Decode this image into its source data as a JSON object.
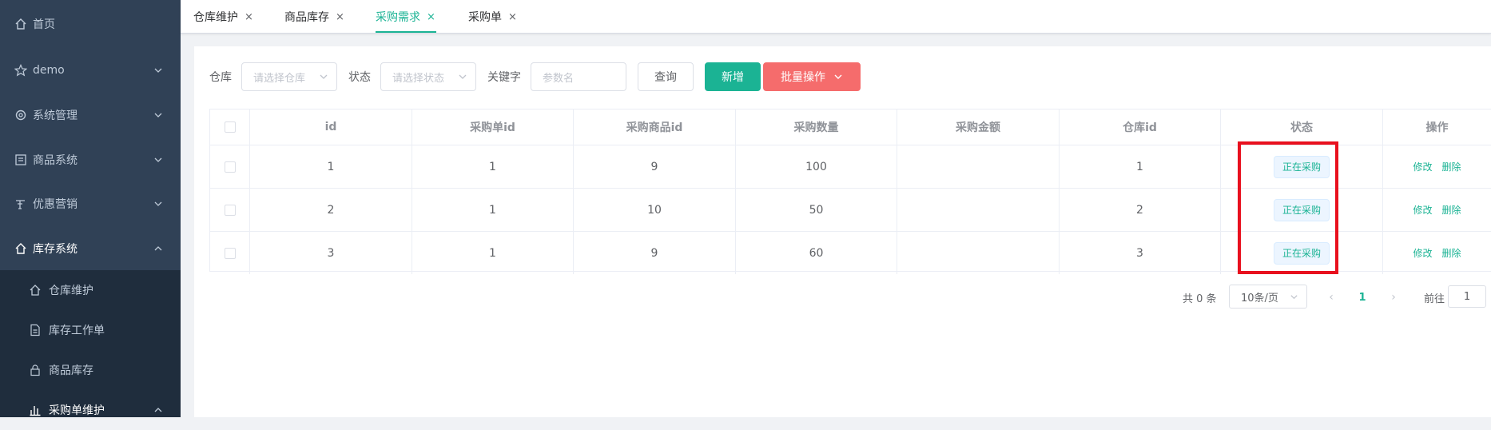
{
  "sidebar": {
    "items": [
      {
        "label": "首页",
        "icon": "home-icon"
      },
      {
        "label": "demo",
        "icon": "star-icon"
      },
      {
        "label": "系统管理",
        "icon": "gear-icon"
      },
      {
        "label": "商品系统",
        "icon": "product-icon"
      },
      {
        "label": "优惠营销",
        "icon": "coupon-icon"
      },
      {
        "label": "库存系统",
        "icon": "home-icon"
      }
    ],
    "sub_items": [
      {
        "label": "仓库维护",
        "icon": "home-icon"
      },
      {
        "label": "库存工作单",
        "icon": "document-icon"
      },
      {
        "label": "商品库存",
        "icon": "lock-icon"
      },
      {
        "label": "采购单维护",
        "icon": "chart-icon"
      }
    ]
  },
  "tabs": [
    {
      "label": "仓库维护",
      "close": "×"
    },
    {
      "label": "商品库存",
      "close": "×"
    },
    {
      "label": "采购需求",
      "close": "×"
    },
    {
      "label": "采购单",
      "close": "×"
    }
  ],
  "filters": {
    "warehouse_label": "仓库",
    "warehouse_placeholder": "请选择仓库",
    "status_label": "状态",
    "status_placeholder": "请选择状态",
    "keyword_label": "关键字",
    "keyword_placeholder": "参数名",
    "query_button": "查询",
    "add_button": "新增",
    "batch_button": "批量操作"
  },
  "table": {
    "headers": [
      "id",
      "采购单id",
      "采购商品id",
      "采购数量",
      "采购金额",
      "仓库id",
      "状态",
      "操作"
    ],
    "rows": [
      {
        "id": "1",
        "order_id": "1",
        "sku_id": "9",
        "quantity": "100",
        "amount": "",
        "warehouse_id": "1",
        "status": "正在采购"
      },
      {
        "id": "2",
        "order_id": "1",
        "sku_id": "10",
        "quantity": "50",
        "amount": "",
        "warehouse_id": "2",
        "status": "正在采购"
      },
      {
        "id": "3",
        "order_id": "1",
        "sku_id": "9",
        "quantity": "60",
        "amount": "",
        "warehouse_id": "3",
        "status": "正在采购"
      }
    ],
    "edit_label": "修改",
    "delete_label": "删除"
  },
  "pagination": {
    "total": "共 0 条",
    "page_size": "10条/页",
    "prev": "‹",
    "current": "1",
    "next": "›",
    "goto_label": "前往",
    "goto_value": "1"
  },
  "colors": {
    "accent": "#1bb394",
    "danger": "#f56c6c",
    "sidebar": "#304156",
    "highlight": "#e8101e"
  }
}
